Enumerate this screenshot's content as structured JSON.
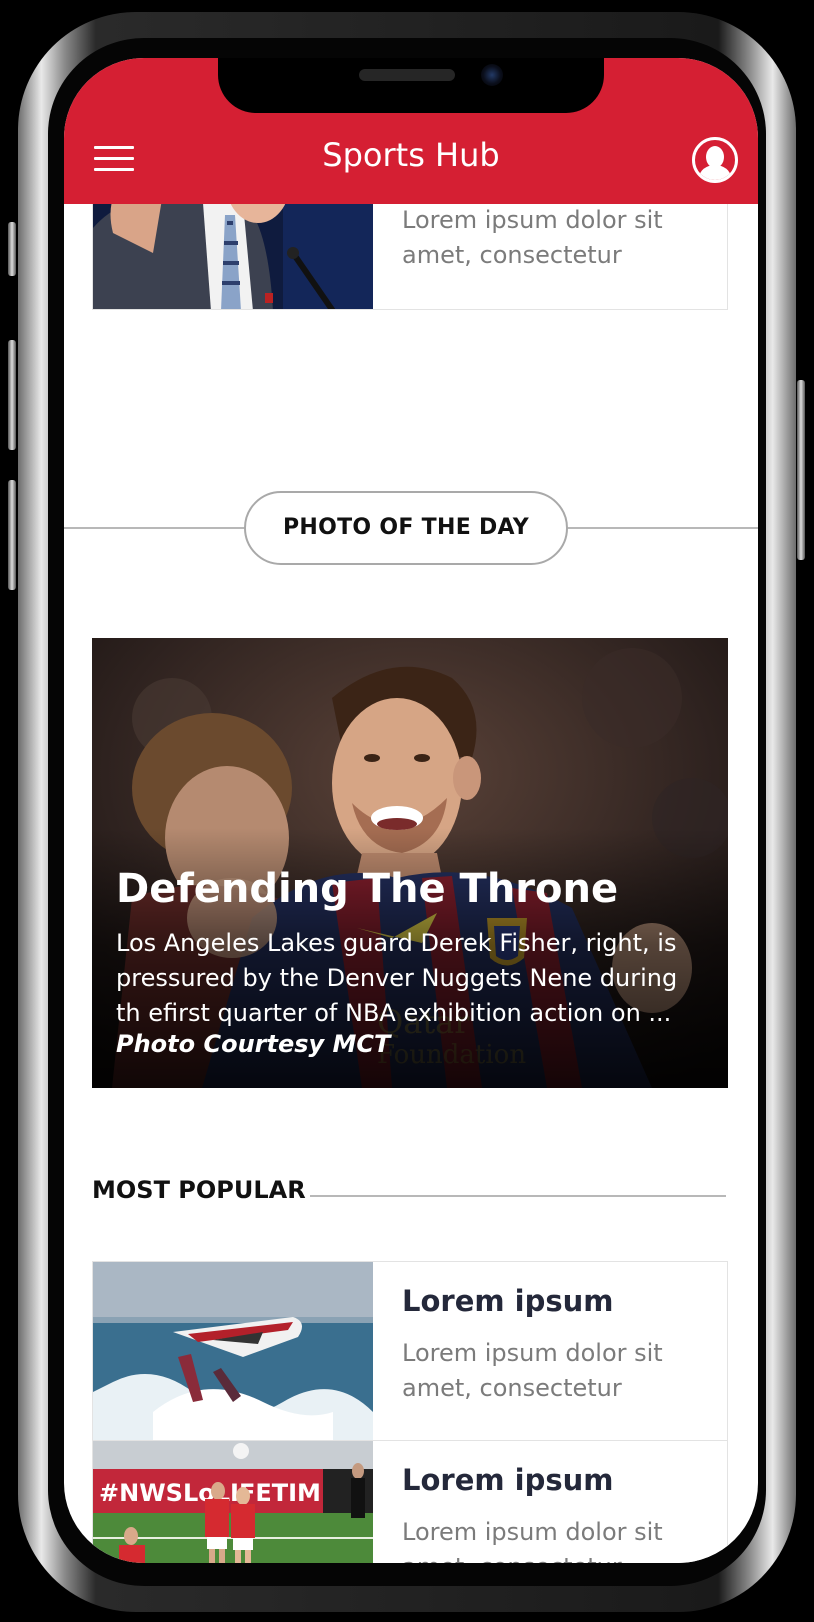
{
  "header": {
    "title": "Sports Hub",
    "menu_icon": "hamburger-menu-icon",
    "profile_icon": "user-profile-icon",
    "background": "#d51f33"
  },
  "top_card": {
    "description": "Lorem ipsum dolor sit amet, consectetur"
  },
  "photo_of_the_day": {
    "label": "PHOTO OF THE DAY",
    "title": "Defending The Throne",
    "description": "Los Angeles Lakes guard Derek Fisher, right, is pressured by the Denver Nuggets Nene during th efirst quarter of NBA exhibition action on ...",
    "credit": "Photo Courtesy MCT"
  },
  "most_popular": {
    "label": "MOST POPULAR",
    "items": [
      {
        "title": "Lorem ipsum",
        "description": "Lorem ipsum dolor sit amet, consectetur"
      },
      {
        "title": "Lorem ipsum",
        "description": "Lorem ipsum dolor sit amet, consectetur"
      }
    ]
  }
}
